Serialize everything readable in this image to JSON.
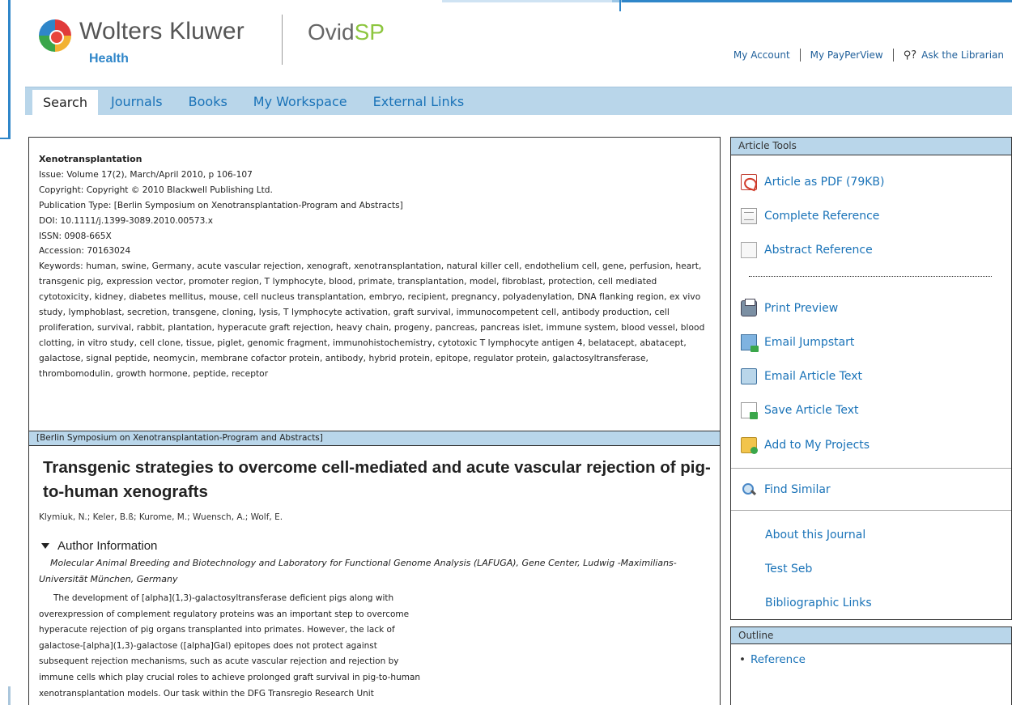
{
  "header": {
    "brand_name": "Wolters Kluwer",
    "brand_sub": "Health",
    "product_prefix": "Ovid",
    "product_suffix": "SP",
    "links": {
      "my_account": "My Account",
      "my_payperview": "My PayPerView",
      "ask_librarian": "Ask the Librarian"
    }
  },
  "nav": {
    "tabs": [
      {
        "label": "Search",
        "active": true
      },
      {
        "label": "Journals",
        "active": false
      },
      {
        "label": "Books",
        "active": false
      },
      {
        "label": "My Workspace",
        "active": false
      },
      {
        "label": "External Links",
        "active": false
      }
    ]
  },
  "citation": {
    "journal": "Xenotransplantation",
    "issue": "Issue: Volume 17(2), March/April 2010, p 106-107",
    "copyright": "Copyright: Copyright © 2010 Blackwell Publishing Ltd.",
    "publication_type": "Publication Type: [Berlin Symposium on Xenotransplantation-Program and Abstracts]",
    "doi": "DOI: 10.1111/j.1399-3089.2010.00573.x",
    "issn": "ISSN: 0908-665X",
    "accession": "Accession: 70163024",
    "keywords": "Keywords: human, swine, Germany, acute vascular rejection, xenograft, xenotransplantation, natural killer cell, endothelium cell, gene, perfusion, heart, transgenic pig, expression vector, promoter region, T lymphocyte, blood, primate, transplantation, model, fibroblast, protection, cell mediated cytotoxicity, kidney, diabetes mellitus, mouse, cell nucleus transplantation, embryo, recipient, pregnancy, polyadenylation, DNA flanking region, ex vivo study, lymphoblast, secretion, transgene, cloning, lysis, T lymphocyte activation, graft survival, immunocompetent cell, antibody production, cell proliferation, survival, rabbit, plantation, hyperacute graft rejection, heavy chain, progeny, pancreas, pancreas islet, immune system, blood vessel, blood clotting, in vitro study, cell clone, tissue, piglet, genomic fragment, immunohistochemistry, cytotoxic T lymphocyte antigen 4, belatacept, abatacept, galactose, signal peptide, neomycin, membrane cofactor protein, antibody, hybrid protein, epitope, regulator protein, galactosyltransferase, thrombomodulin, growth hormone, peptide, receptor"
  },
  "article": {
    "section": "[Berlin Symposium on Xenotransplantation-Program and Abstracts]",
    "title": "Transgenic strategies to overcome cell-mediated and acute vascular rejection of pig-to-human xenografts",
    "authors": "Klymiuk, N.; Keler, B.ß; Kurome, M.; Wuensch, A.; Wolf, E.",
    "author_info_label": "Author Information",
    "affiliation": "Molecular Animal Breeding and Biotechnology and Laboratory for Functional Genome Analysis (LAFUGA), Gene Center, Ludwig -Maximilians-Universität München, Germany",
    "abstract_lines": [
      "The development of [alpha](1,3)-galactosyltransferase deficient pigs along with",
      "overexpression of complement regulatory proteins was an important step to overcome",
      "hyperacute rejection of pig organs transplanted into primates. However, the lack of",
      "galactose-[alpha](1,3)-galactose ([alpha]Gal) epitopes does not protect against",
      "subsequent rejection mechanisms, such as acute vascular rejection and rejection by",
      "immune cells which play crucial roles to achieve prolonged graft survival in pig-to-human",
      "xenotransplantation models. Our task within the DFG Transregio Research Unit"
    ]
  },
  "tools": {
    "header": "Article Tools",
    "pdf_label": "Article as PDF",
    "pdf_size": "(79KB)",
    "complete_reference": "Complete Reference",
    "abstract_reference": "Abstract Reference",
    "print_preview": "Print Preview",
    "email_jumpstart": "Email Jumpstart",
    "email_article_text": "Email Article Text",
    "save_article_text": "Save Article Text",
    "add_to_projects": "Add to My Projects",
    "find_similar": "Find Similar",
    "about_journal": "About this Journal",
    "test_seb": "Test Seb",
    "bibliographic_links": "Bibliographic Links"
  },
  "outline": {
    "header": "Outline",
    "items": [
      "Reference"
    ]
  },
  "colors": {
    "accent": "#1a73b8",
    "nav_bg": "#b9d6ea",
    "brand_green": "#8dc63f",
    "frame_blue": "#2f86c9"
  }
}
